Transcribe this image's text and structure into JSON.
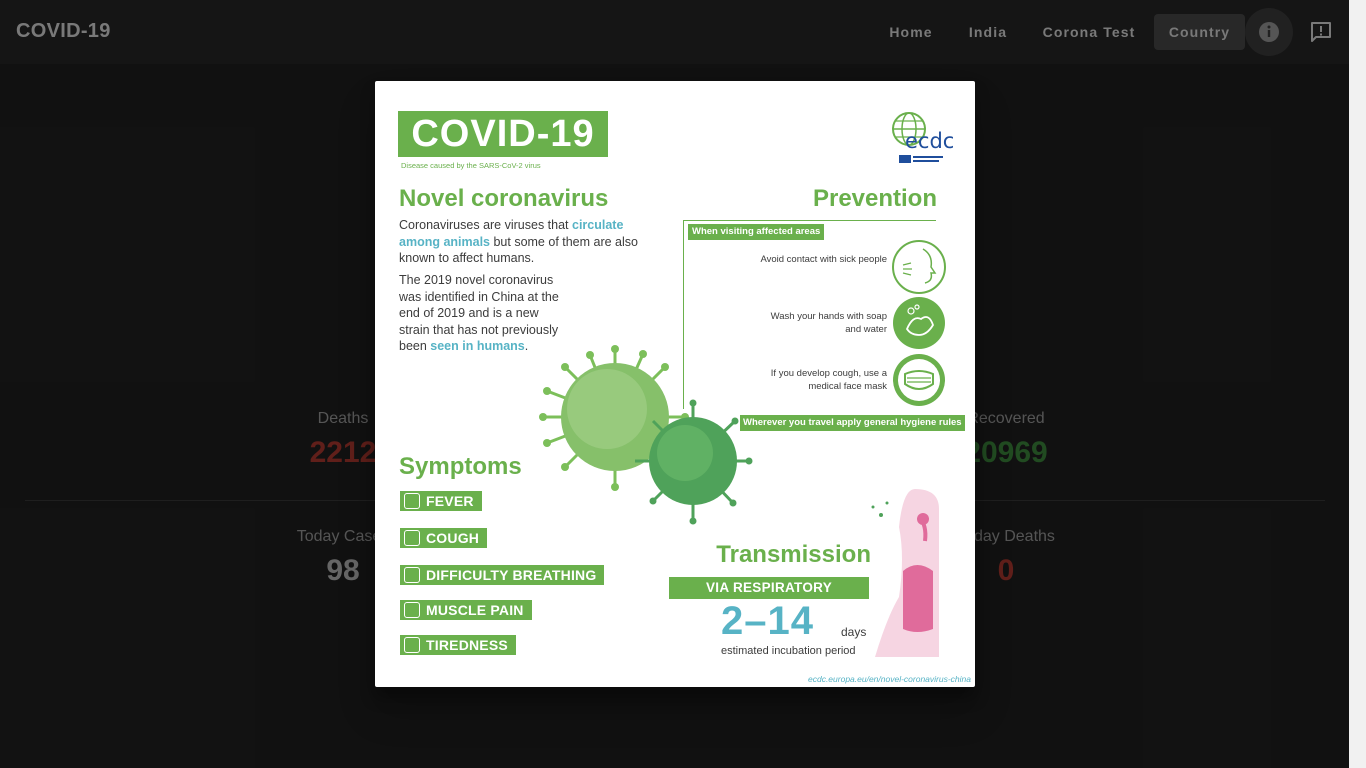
{
  "app": {
    "title": "COVID-19",
    "nav": [
      "Home",
      "India",
      "Corona Test",
      "Country"
    ],
    "active_nav": "Country"
  },
  "icons": {
    "info": "info-icon",
    "feedback": "feedback-icon"
  },
  "stats": {
    "deaths_label": "Deaths",
    "deaths_value": "2212",
    "recovered_label": "Recovered",
    "recovered_value": "20969",
    "today_cases_label": "Today Cases",
    "today_cases_value": "98",
    "today_deaths_label": "Today Deaths",
    "today_deaths_value": "0"
  },
  "infographic": {
    "title": "COVID-19",
    "subtitle": "Disease caused by the SARS-CoV-2 virus",
    "logo": "ecdc",
    "novel_heading": "Novel coronavirus",
    "novel_p1_a": "Coronaviruses are viruses that ",
    "novel_p1_b": "circulate among animals",
    "novel_p1_c": " but some of them are also known to affect humans.",
    "novel_p2_a": "The 2019 novel coronavirus was identified in China at the end of 2019 and is a new strain that has not previously been ",
    "novel_p2_b": "seen in humans",
    "novel_p2_c": ".",
    "prevention_heading": "Prevention",
    "prevention_tag": "When visiting affected areas",
    "prevention_items": [
      "Avoid contact with sick people",
      "Wash your hands with soap and water",
      "If you develop cough, use a medical face mask"
    ],
    "prevention_footer": "Wherever you travel apply general hygiene rules",
    "symptoms_heading": "Symptoms",
    "symptoms": [
      "FEVER",
      "COUGH",
      "DIFFICULTY BREATHING",
      "MUSCLE PAIN",
      "TIREDNESS"
    ],
    "transmission_heading": "Transmission",
    "transmission_tag": "VIA RESPIRATORY DROPLETS",
    "incubation_value": "2–14",
    "incubation_unit": "days",
    "incubation_label": "estimated incubation period",
    "source_url": "ecdc.europa.eu/en/novel-coronavirus-china"
  },
  "colors": {
    "deaths": "#b23a30",
    "recovered": "#3d8b3d",
    "today_cases": "#bdbdbd",
    "brand_green": "#6ab04c"
  }
}
